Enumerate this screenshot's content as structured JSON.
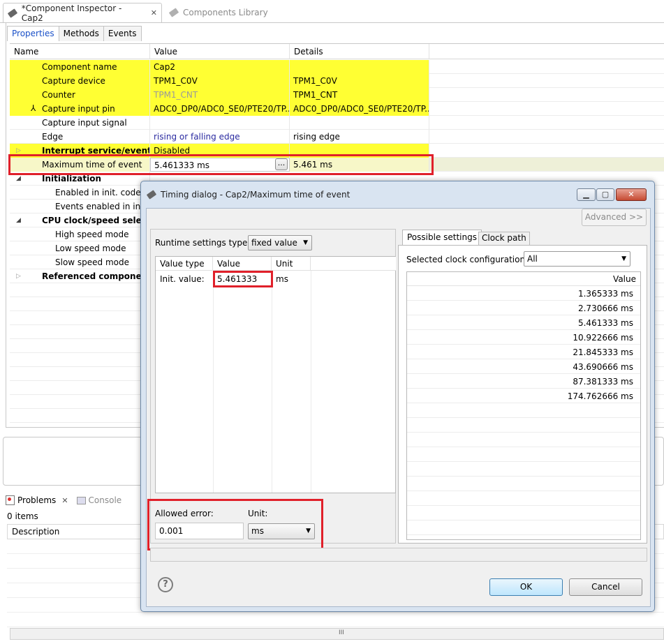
{
  "editor_tabs": [
    {
      "label": "*Component Inspector - Cap2",
      "icon": "component-chip-icon",
      "active": true
    },
    {
      "label": "Components Library",
      "icon": "component-chip-icon",
      "active": false
    }
  ],
  "properties_tabs": [
    "Properties",
    "Methods",
    "Events"
  ],
  "grid": {
    "columns": [
      "Name",
      "Value",
      "Details"
    ],
    "rows": [
      {
        "name": "Component name",
        "value": "Cap2",
        "details": ""
      },
      {
        "name": "Capture device",
        "value": "TPM1_C0V",
        "details": "TPM1_C0V"
      },
      {
        "name": "Counter",
        "value": "TPM1_CNT",
        "details": "TPM1_CNT"
      },
      {
        "name": "Capture input pin",
        "value": "ADC0_DP0/ADC0_SE0/PTE20/TP...",
        "details": "ADC0_DP0/ADC0_SE0/PTE20/TP..."
      },
      {
        "name": "Capture input signal",
        "value": "",
        "details": ""
      },
      {
        "name": "Edge",
        "value": "rising or falling edge",
        "details": "rising edge"
      },
      {
        "name": "Interrupt service/event",
        "value": "Disabled",
        "details": ""
      },
      {
        "name": "Maximum time of event",
        "value": "5.461333 ms",
        "details": "5.461 ms",
        "button": "..."
      },
      {
        "name": "Initialization",
        "value": "",
        "details": ""
      },
      {
        "name": "Enabled in init. code",
        "value": "",
        "details": ""
      },
      {
        "name": "Events enabled in init",
        "value": "",
        "details": ""
      },
      {
        "name": "CPU clock/speed select",
        "value": "",
        "details": ""
      },
      {
        "name": "High speed mode",
        "value": "",
        "details": ""
      },
      {
        "name": "Low speed mode",
        "value": "",
        "details": ""
      },
      {
        "name": "Slow speed mode",
        "value": "",
        "details": ""
      },
      {
        "name": "Referenced component",
        "value": "",
        "details": ""
      }
    ]
  },
  "bottom": {
    "tabs": [
      "Problems",
      "Console"
    ],
    "items_count": "0 items",
    "column": "Description",
    "scroll_grip": "III"
  },
  "dialog": {
    "title": "Timing dialog - Cap2/Maximum time of event",
    "advanced_button": "Advanced >>",
    "runtime_label": "Runtime settings type:",
    "runtime_value": "fixed value",
    "table_columns": [
      "Value type",
      "Value",
      "Unit"
    ],
    "table_row": {
      "type": "Init. value:",
      "value": "5.461333",
      "unit": "ms"
    },
    "allowed_error_label": "Allowed error:",
    "allowed_error_value": "0.001",
    "unit_label": "Unit:",
    "unit_value": "ms",
    "right_tabs": [
      "Possible settings",
      "Clock path"
    ],
    "clock_config_label": "Selected clock configuration",
    "clock_config_value": "All",
    "possible_header": "Value",
    "possible_values": [
      "1.365333 ms",
      "2.730666 ms",
      "5.461333 ms",
      "10.922666 ms",
      "21.845333 ms",
      "43.690666 ms",
      "87.381333 ms",
      "174.762666 ms"
    ],
    "ok_label": "OK",
    "cancel_label": "Cancel",
    "help_icon": "?"
  },
  "colors": {
    "highlight": "#ffff33",
    "selection_red": "#e0202a",
    "tab_blue": "#1a50c8"
  }
}
